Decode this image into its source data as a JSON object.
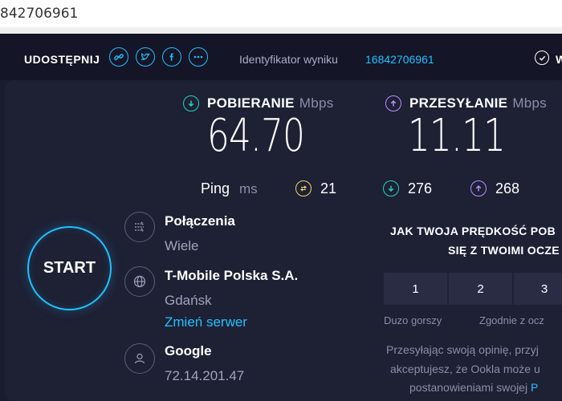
{
  "browser": {
    "url_text": "842706961"
  },
  "topbar": {
    "share_label": "UDOSTĘPNIJ",
    "share_icons": [
      "link-icon",
      "twitter-icon",
      "facebook-icon",
      "more-icon"
    ],
    "result_label": "Identyfikator wyniku",
    "result_id": "16842706961",
    "right_label_partial": "W"
  },
  "download": {
    "label": "POBIERANIE",
    "unit": "Mbps",
    "value": "64.70",
    "color": "#20d3c2"
  },
  "upload": {
    "label": "PRZESYŁANIE",
    "unit": "Mbps",
    "value": "11.11",
    "color": "#b98cff"
  },
  "ping": {
    "label": "Ping",
    "unit": "ms",
    "idle": "21",
    "download": "276",
    "upload": "268",
    "idle_color": "#f2d46b"
  },
  "start_label": "START",
  "connections": {
    "title": "Połączenia",
    "value": "Wiele"
  },
  "provider": {
    "title": "T-Mobile Polska S.A.",
    "location": "Gdańsk",
    "change_link": "Zmień serwer"
  },
  "host": {
    "title": "Google",
    "ip": "72.14.201.47"
  },
  "rating": {
    "question_line1": "JAK TWOJA PRĘDKOŚĆ POB",
    "question_line2": "SIĘ Z TWOIMI OCZE",
    "options": [
      "1",
      "2",
      "3"
    ],
    "caption_left": "Duzo gorszy",
    "caption_mid": "Zgodnie z ocz"
  },
  "consent": {
    "line1": "Przesyłając swoją opinię, przyj",
    "line2": "akceptujesz, że Ookla może u",
    "line3_text": "postanowieniami swojej ",
    "line3_link": "P"
  }
}
